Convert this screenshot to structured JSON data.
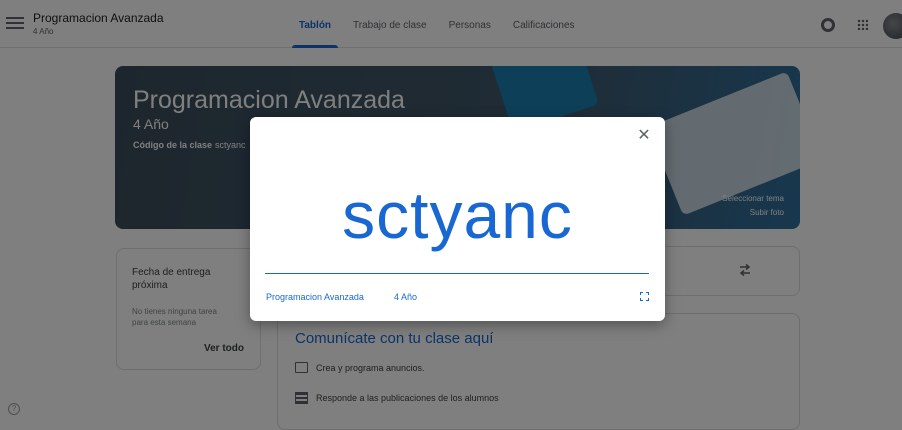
{
  "header": {
    "class_name": "Programacion Avanzada",
    "class_section": "4 Año",
    "tabs": [
      {
        "label": "Tablón",
        "active": true
      },
      {
        "label": "Trabajo de clase",
        "active": false
      },
      {
        "label": "Personas",
        "active": false
      },
      {
        "label": "Calificaciones",
        "active": false
      }
    ],
    "icons": [
      "menu-icon",
      "gear-icon",
      "apps-grid-icon",
      "avatar"
    ]
  },
  "banner": {
    "title": "Programacion Avanzada",
    "section": "4 Año",
    "code_label": "Código de la clase",
    "code_value": "sctyanc",
    "select_theme": "Seleccionar tema",
    "upload_photo": "Subir foto"
  },
  "due_card": {
    "title": "Fecha de entrega próxima",
    "text": "No tienes ninguna tarea para esta semana",
    "link": "Ver todo"
  },
  "stream": {
    "title": "Comunícate con tu clase aquí",
    "items": [
      {
        "icon": "chat-icon",
        "label": "Crea y programa anuncios."
      },
      {
        "icon": "feed-icon",
        "label": "Responde a las publicaciones de los alumnos"
      }
    ]
  },
  "dialog": {
    "code": "sctyanc",
    "class_name": "Programacion Avanzada",
    "class_section": "4 Año",
    "icons": [
      "close-icon",
      "fullscreen-icon"
    ]
  },
  "colors": {
    "accent": "#1967d2",
    "banner": "#40586a",
    "scrim": "rgba(0,0,0,0.5)"
  }
}
